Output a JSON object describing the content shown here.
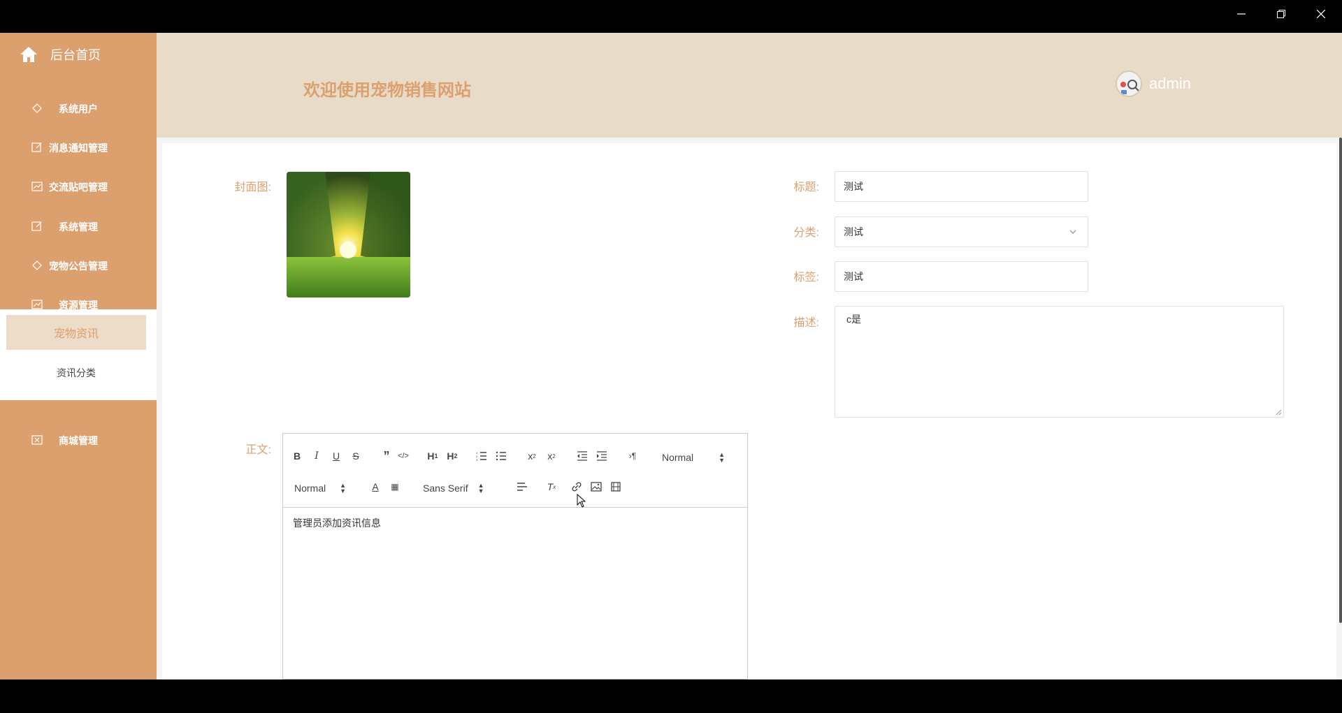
{
  "window": {
    "minimize": "minimize",
    "restore": "restore",
    "close": "close"
  },
  "sidebar": {
    "home": "后台首页",
    "items": [
      {
        "label": "系统用户",
        "icon": "diamond-icon"
      },
      {
        "label": "消息通知管理",
        "icon": "edit-icon"
      },
      {
        "label": "交流贴吧管理",
        "icon": "chart-icon"
      },
      {
        "label": "系统管理",
        "icon": "edit-icon"
      },
      {
        "label": "宠物公告管理",
        "icon": "diamond-icon"
      },
      {
        "label": "资源管理",
        "icon": "chart-icon"
      }
    ],
    "active_group": "宠物资讯",
    "sub_item": "资讯分类",
    "last_item": "商城管理"
  },
  "header": {
    "title": "欢迎使用宠物销售网站",
    "user": "admin"
  },
  "form": {
    "cover_label": "封面图:",
    "title_label": "标题:",
    "title_value": "测试",
    "category_label": "分类:",
    "category_value": "测试",
    "tag_label": "标签:",
    "tag_value": "测试",
    "desc_label": "描述:",
    "desc_value": "c是",
    "body_label": "正文:"
  },
  "editor": {
    "header_select": "Normal",
    "size_select": "Normal",
    "font_select": "Sans Serif",
    "content": "管理员添加资讯信息"
  },
  "colors": {
    "sidebar": "#dca06f",
    "header": "#e8dcc9",
    "accent": "#dca06f"
  }
}
